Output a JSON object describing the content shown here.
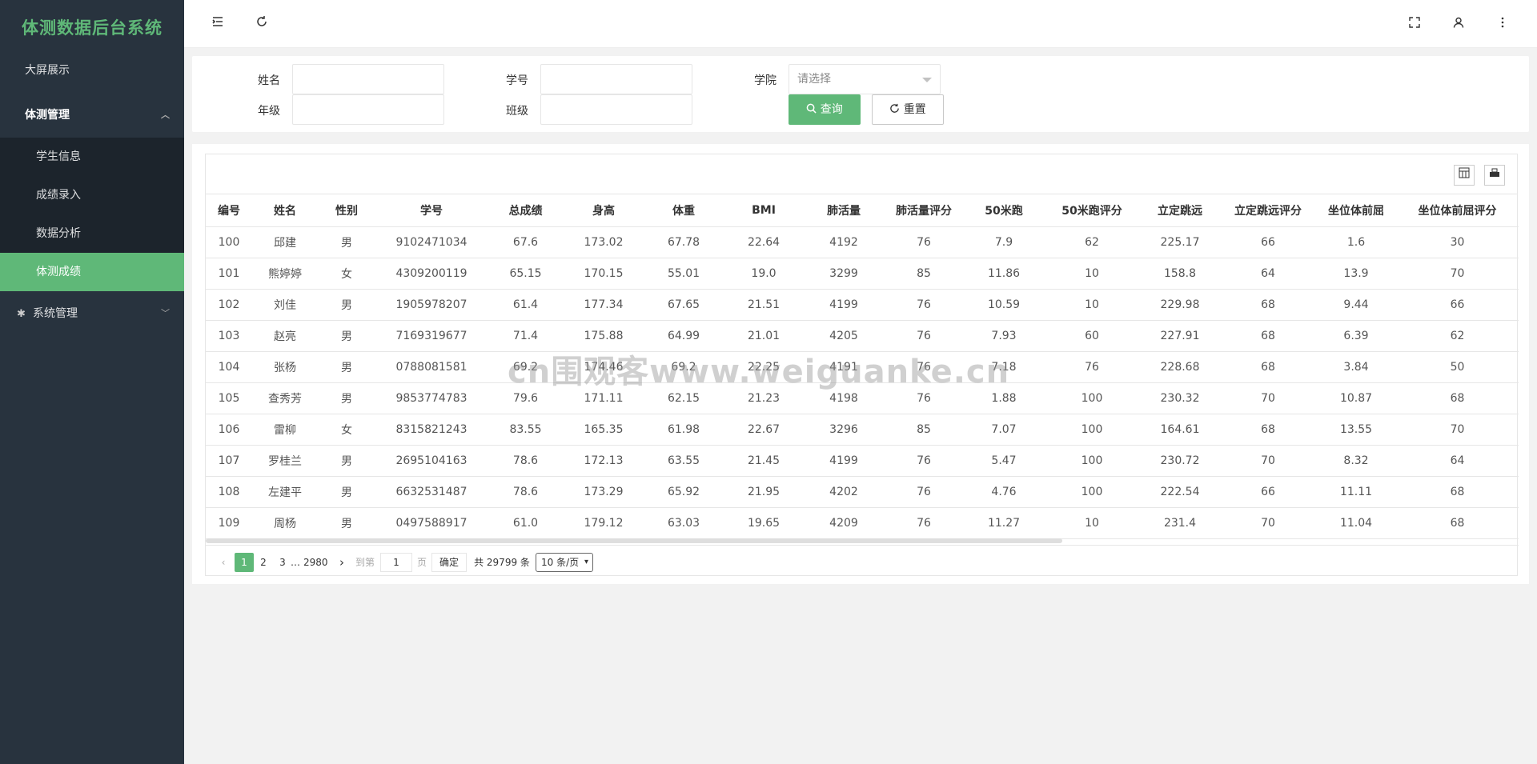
{
  "app": {
    "title": "体测数据后台系统"
  },
  "sidebar": {
    "items": [
      {
        "label": "大屏展示"
      },
      {
        "label": "体测管理",
        "expanded": true,
        "children": [
          {
            "label": "学生信息"
          },
          {
            "label": "成绩录入"
          },
          {
            "label": "数据分析"
          },
          {
            "label": "体测成绩",
            "active": true
          }
        ]
      },
      {
        "label": "系统管理"
      }
    ]
  },
  "header": {
    "icons": [
      "menu-fold-icon",
      "refresh-icon",
      "fullscreen-icon",
      "user-icon",
      "more-icon"
    ]
  },
  "search": {
    "name_label": "姓名",
    "student_no_label": "学号",
    "college_label": "学院",
    "college_placeholder": "请选择",
    "grade_label": "年级",
    "class_label": "班级",
    "query_button": "查询",
    "reset_button": "重置"
  },
  "table": {
    "columns": [
      "编号",
      "姓名",
      "性别",
      "学号",
      "总成绩",
      "身高",
      "体重",
      "BMI",
      "肺活量",
      "肺活量评分",
      "50米跑",
      "50米跑评分",
      "立定跳远",
      "立定跳远评分",
      "坐位体前屈",
      "坐位体前屈评分"
    ],
    "rows": [
      [
        "100",
        "邱建",
        "男",
        "9102471034",
        "67.6",
        "173.02",
        "67.78",
        "22.64",
        "4192",
        "76",
        "7.9",
        "62",
        "225.17",
        "66",
        "1.6",
        "30"
      ],
      [
        "101",
        "熊婷婷",
        "女",
        "4309200119",
        "65.15",
        "170.15",
        "55.01",
        "19.0",
        "3299",
        "85",
        "11.86",
        "10",
        "158.8",
        "64",
        "13.9",
        "70"
      ],
      [
        "102",
        "刘佳",
        "男",
        "1905978207",
        "61.4",
        "177.34",
        "67.65",
        "21.51",
        "4199",
        "76",
        "10.59",
        "10",
        "229.98",
        "68",
        "9.44",
        "66"
      ],
      [
        "103",
        "赵亮",
        "男",
        "7169319677",
        "71.4",
        "175.88",
        "64.99",
        "21.01",
        "4205",
        "76",
        "7.93",
        "60",
        "227.91",
        "68",
        "6.39",
        "62"
      ],
      [
        "104",
        "张杨",
        "男",
        "0788081581",
        "69.2",
        "174.46",
        "69.2",
        "22.25",
        "4191",
        "76",
        "7.18",
        "76",
        "228.68",
        "68",
        "3.84",
        "50"
      ],
      [
        "105",
        "查秀芳",
        "男",
        "9853774783",
        "79.6",
        "171.11",
        "62.15",
        "21.23",
        "4198",
        "76",
        "1.88",
        "100",
        "230.32",
        "70",
        "10.87",
        "68"
      ],
      [
        "106",
        "雷柳",
        "女",
        "8315821243",
        "83.55",
        "165.35",
        "61.98",
        "22.67",
        "3296",
        "85",
        "7.07",
        "100",
        "164.61",
        "68",
        "13.55",
        "70"
      ],
      [
        "107",
        "罗桂兰",
        "男",
        "2695104163",
        "78.6",
        "172.13",
        "63.55",
        "21.45",
        "4199",
        "76",
        "5.47",
        "100",
        "230.72",
        "70",
        "8.32",
        "64"
      ],
      [
        "108",
        "左建平",
        "男",
        "6632531487",
        "78.6",
        "173.29",
        "65.92",
        "21.95",
        "4202",
        "76",
        "4.76",
        "100",
        "222.54",
        "66",
        "11.11",
        "68"
      ],
      [
        "109",
        "周杨",
        "男",
        "0497588917",
        "61.0",
        "179.12",
        "63.03",
        "19.65",
        "4209",
        "76",
        "11.27",
        "10",
        "231.4",
        "70",
        "11.04",
        "68"
      ]
    ]
  },
  "pagination": {
    "current": "1",
    "page2": "2",
    "page3": "3",
    "ellipsis": "…",
    "last": "2980",
    "goto_label": "到第",
    "goto_value": "1",
    "page_unit": "页",
    "confirm": "确定",
    "total": "共 29799 条",
    "page_size": "10 条/页"
  },
  "watermark": "cn围观客www.weiguanke.cn",
  "colors": {
    "accent": "#5fb878",
    "sidebar_bg": "#28333e",
    "submenu_bg": "#1c242c"
  }
}
